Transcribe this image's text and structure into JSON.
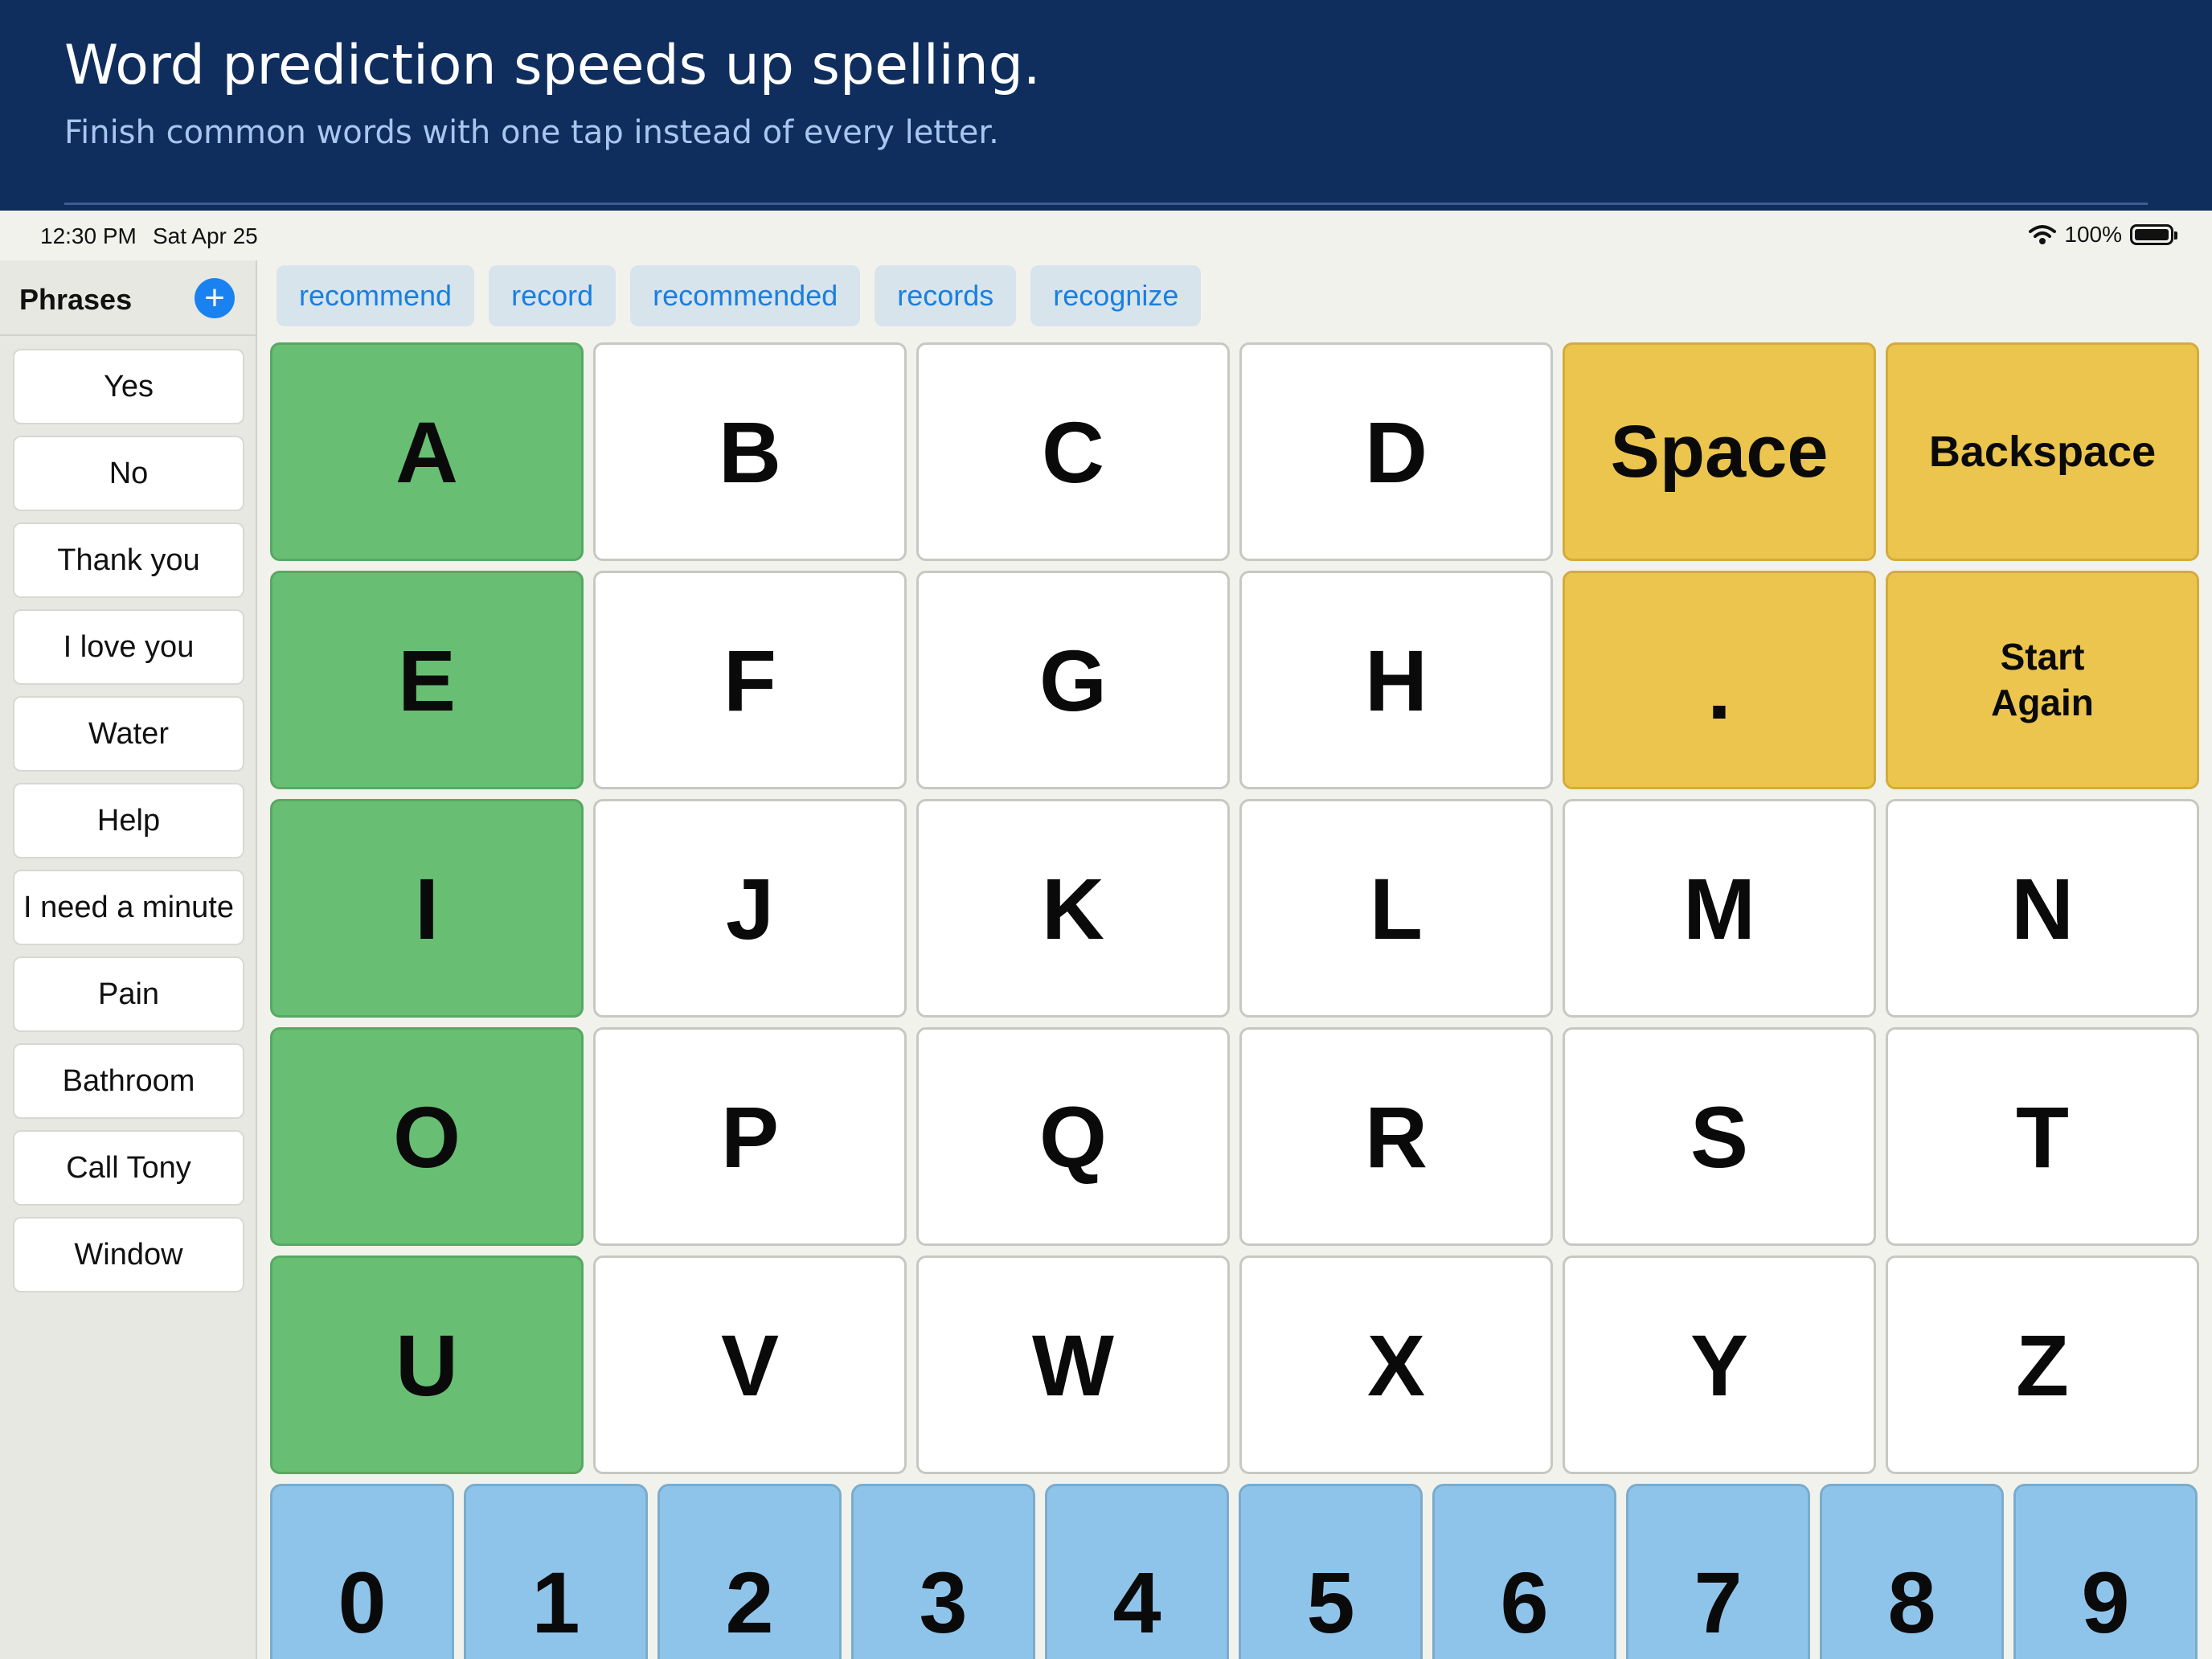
{
  "banner": {
    "title": "Word prediction speeds up spelling.",
    "subtitle": "Finish common words with one tap instead of every letter."
  },
  "status_bar": {
    "time": "12:30 PM",
    "date": "Sat Apr 25",
    "battery": "100%",
    "icons": [
      "wifi-icon",
      "battery-icon"
    ]
  },
  "sidebar": {
    "title": "Phrases",
    "add_icon": "plus-circle-icon",
    "phrases": [
      "Yes",
      "No",
      "Thank you",
      "I love you",
      "Water",
      "Help",
      "I need a minute",
      "Pain",
      "Bathroom",
      "Call Tony",
      "Window"
    ]
  },
  "predictions": [
    "recommend",
    "record",
    "recommended",
    "records",
    "recognize"
  ],
  "keyboard": {
    "rows": [
      [
        "A",
        "B",
        "C",
        "D",
        "Space",
        "Backspace"
      ],
      [
        "E",
        "F",
        "G",
        "H",
        ".",
        "Start\nAgain"
      ],
      [
        "I",
        "J",
        "K",
        "L",
        "M",
        "N"
      ],
      [
        "O",
        "P",
        "Q",
        "R",
        "S",
        "T"
      ],
      [
        "U",
        "V",
        "W",
        "X",
        "Y",
        "Z"
      ]
    ],
    "numbers": [
      "0",
      "1",
      "2",
      "3",
      "4",
      "5",
      "6",
      "7",
      "8",
      "9"
    ]
  },
  "colors": {
    "banner_bg": "#0f2e5e",
    "vowel_key": "#68bf74",
    "function_key": "#ecc54e",
    "number_key": "#8fc4ea",
    "prediction_text": "#1a7fe0",
    "add_button": "#1a82f0"
  }
}
